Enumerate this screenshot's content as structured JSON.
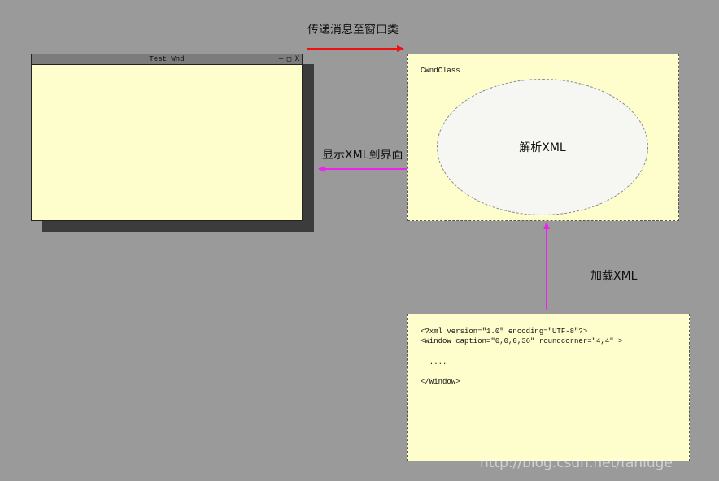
{
  "labels": {
    "send_message": "传递消息至窗口类",
    "show_xml": "显示XML到界面",
    "load_xml": "加载XML"
  },
  "test_window": {
    "title": "Test Wnd",
    "controls": {
      "minimize": "–",
      "maximize": "□",
      "close": "X"
    }
  },
  "window_class": {
    "label": "CWndClass",
    "ellipse_label": "解析XML"
  },
  "xml": {
    "line1": "<?xml version=\"1.0\" encoding=\"UTF-8\"?>",
    "line2": "<Window caption=\"0,0,0,36\" roundcorner=\"4,4\" >",
    "line3": "  ....",
    "line4": "</Window>"
  },
  "watermark": "http://blog.csdn.net/fanluge",
  "colors": {
    "background": "#9a9a9a",
    "panel": "#fefdcc",
    "arrow_red": "#ee1111",
    "arrow_magenta": "#ee22ee"
  }
}
